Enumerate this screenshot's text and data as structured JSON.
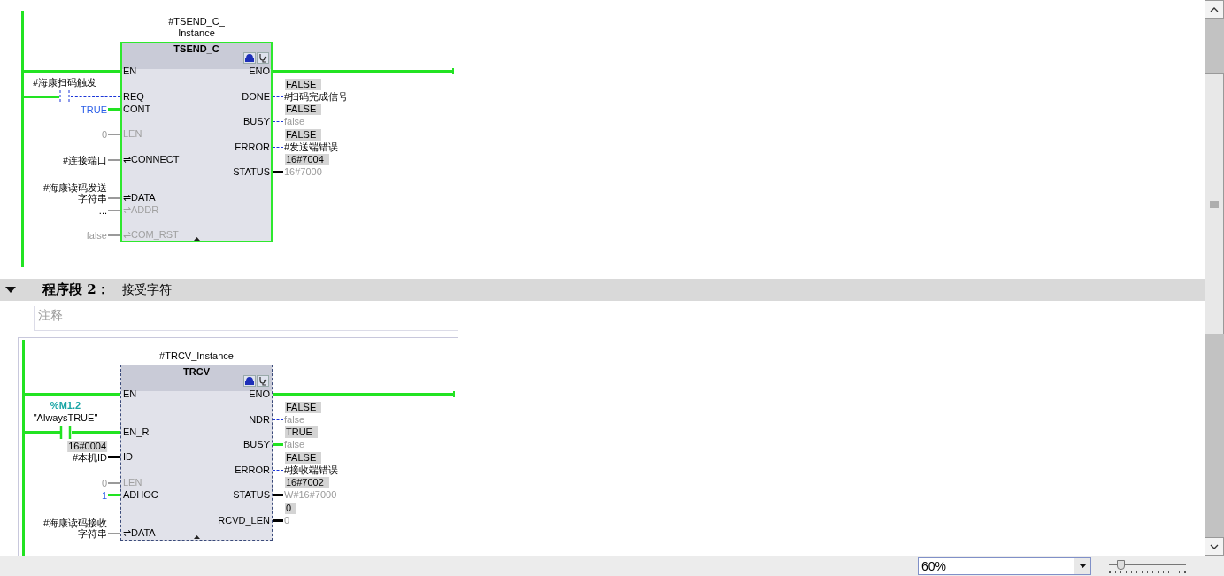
{
  "networks": [
    {
      "block": {
        "instance": [
          "#TSEND_C_",
          "Instance"
        ],
        "type": "TSEND_C",
        "powered": true,
        "inputs": [
          {
            "kind": "enable",
            "name": "EN",
            "powered": true,
            "disabled": false
          },
          {
            "kind": "contact",
            "name": "REQ",
            "operand": [
              "#海康扫码触发"
            ],
            "powered": false,
            "disabled": false
          },
          {
            "kind": "bool",
            "name": "CONT",
            "actual": [
              "TRUE"
            ],
            "literal": true,
            "greyed": false,
            "powered": true,
            "disabled": false
          },
          {
            "kind": "parameter",
            "name": "LEN",
            "actual": [
              "0"
            ],
            "literal": false,
            "greyed": true,
            "disabled": true
          },
          {
            "kind": "parameter",
            "name": "⇌CONNECT",
            "actual": [
              "#连接端口"
            ],
            "literal": false,
            "greyed": false,
            "disabled": false
          },
          {
            "kind": "parameter",
            "name": "⇌DATA",
            "actual": [
              "#海康读码发送",
              "字符串"
            ],
            "literal": false,
            "greyed": false,
            "disabled": false
          },
          {
            "kind": "parameter",
            "name": "⇌ADDR",
            "actual": [
              "..."
            ],
            "literal": false,
            "greyed": false,
            "disabled": true
          },
          {
            "kind": "parameter",
            "name": "⇌COM_RST",
            "actual": [
              "false"
            ],
            "literal": false,
            "greyed": true,
            "disabled": true
          }
        ],
        "outputs": [
          {
            "kind": "enable",
            "name": "ENO",
            "powered": true
          },
          {
            "kind": "bool",
            "name": "DONE",
            "monitor": "FALSE",
            "actual": "#扫码完成信号",
            "literal": false,
            "greyed": false,
            "powered": false
          },
          {
            "kind": "bool",
            "name": "BUSY",
            "monitor": "FALSE",
            "actual": "false",
            "literal": false,
            "greyed": true,
            "powered": false
          },
          {
            "kind": "bool",
            "name": "ERROR",
            "monitor": "FALSE",
            "actual": "#发送端错误",
            "literal": false,
            "greyed": false,
            "powered": false
          },
          {
            "kind": "word",
            "name": "STATUS",
            "monitor": "16#7004",
            "actual": "16#7000",
            "literal": false,
            "greyed": true
          }
        ]
      }
    },
    {
      "header": {
        "expanded": true,
        "number": "程序段 2：",
        "title": "接受字符"
      },
      "comment": {
        "placeholder": "注释"
      },
      "block": {
        "instance": [
          "#TRCV_Instance"
        ],
        "type": "TRCV",
        "powered": false,
        "inputs": [
          {
            "kind": "enable",
            "name": "EN",
            "powered": true,
            "disabled": false
          },
          {
            "kind": "contact",
            "name": "EN_R",
            "address": "%M1.2",
            "operand": [
              "\"AlwaysTRUE\""
            ],
            "powered": true,
            "disabled": false
          },
          {
            "kind": "word",
            "name": "ID",
            "monitor": "16#0004",
            "actual": [
              "#本机ID"
            ],
            "literal": false,
            "greyed": false,
            "disabled": false
          },
          {
            "kind": "parameter",
            "name": "LEN",
            "actual": [
              "0"
            ],
            "literal": false,
            "greyed": true,
            "disabled": true
          },
          {
            "kind": "bool",
            "name": "ADHOC",
            "actual": [
              "1"
            ],
            "literal": true,
            "greyed": false,
            "powered": true,
            "disabled": false
          },
          {
            "kind": "parameter",
            "name": "⇌DATA",
            "actual": [
              "#海康读码接收",
              "字符串"
            ],
            "literal": false,
            "greyed": false,
            "disabled": false
          }
        ],
        "outputs": [
          {
            "kind": "enable",
            "name": "ENO",
            "powered": true
          },
          {
            "kind": "bool",
            "name": "NDR",
            "monitor": "FALSE",
            "actual": "false",
            "literal": false,
            "greyed": true,
            "powered": false
          },
          {
            "kind": "bool",
            "name": "BUSY",
            "monitor": "TRUE",
            "actual": "false",
            "literal": false,
            "greyed": true,
            "powered": true
          },
          {
            "kind": "bool",
            "name": "ERROR",
            "monitor": "FALSE",
            "actual": "#接收端错误",
            "literal": false,
            "greyed": false,
            "powered": false
          },
          {
            "kind": "word",
            "name": "STATUS",
            "monitor": "16#7002",
            "actual": "W#16#7000",
            "literal": false,
            "greyed": true
          },
          {
            "kind": "word",
            "name": "RCVD_LEN",
            "monitor": "0",
            "actual": "0",
            "literal": false,
            "greyed": true
          }
        ]
      }
    }
  ],
  "zoom": {
    "value": "60%"
  },
  "zoom_slider": {
    "level": 0.15
  }
}
